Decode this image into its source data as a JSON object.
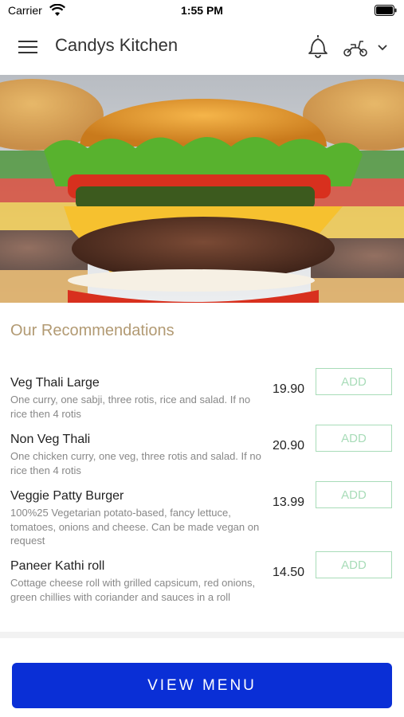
{
  "status_bar": {
    "carrier": "Carrier",
    "time": "1:55 PM"
  },
  "header": {
    "title": "Candys Kitchen"
  },
  "section": {
    "title": "Our Recommendations"
  },
  "items": [
    {
      "name": "Veg Thali Large",
      "description": "One curry, one sabji, three rotis, rice and salad. If no rice then 4 rotis",
      "price": "19.90",
      "add_label": "ADD"
    },
    {
      "name": "Non Veg Thali",
      "description": "One chicken curry, one veg, three rotis and salad. If no rice then 4 rotis",
      "price": "20.90",
      "add_label": "ADD"
    },
    {
      "name": "Veggie Patty Burger",
      "description": "100%25 Vegetarian potato-based, fancy lettuce, tomatoes, onions and cheese. Can be made vegan on request",
      "price": "13.99",
      "add_label": "ADD"
    },
    {
      "name": "Paneer Kathi roll",
      "description": "Cottage cheese roll with grilled capsicum, red onions, green chillies with coriander and sauces in a roll",
      "price": "14.50",
      "add_label": "ADD"
    }
  ],
  "footer": {
    "view_menu_label": "VIEW MENU"
  },
  "colors": {
    "accent": "#0a2fd6",
    "add_border": "#a8dcb8",
    "section_title": "#b29a73"
  }
}
